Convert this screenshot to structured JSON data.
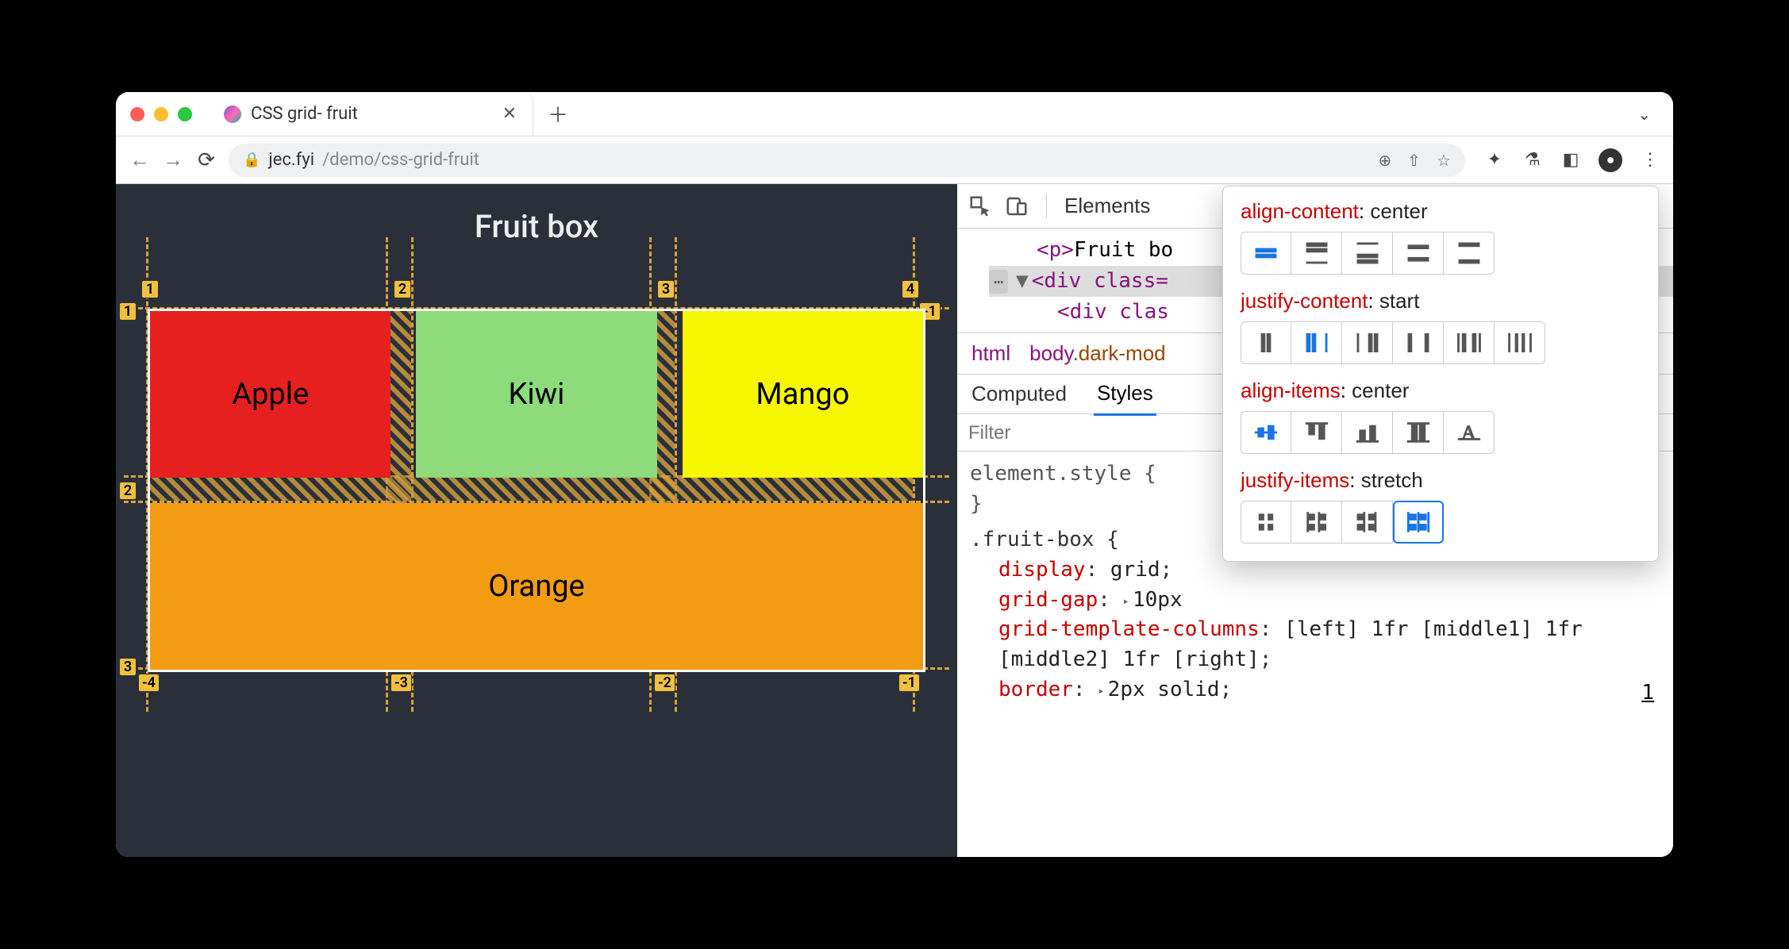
{
  "tab": {
    "title": "CSS grid- fruit"
  },
  "url": {
    "host": "jec.fyi",
    "path": "/demo/css-grid-fruit"
  },
  "page": {
    "heading": "Fruit box",
    "cells": {
      "apple": "Apple",
      "kiwi": "Kiwi",
      "mango": "Mango",
      "orange": "Orange"
    },
    "col_labels_top": [
      "1",
      "2",
      "3",
      "4"
    ],
    "row_labels_left": [
      "1",
      "2",
      "3"
    ],
    "neg_right": "-1",
    "neg_bottom": [
      "-4",
      "-3",
      "-2",
      "-1"
    ]
  },
  "devtools": {
    "main_tab": "Elements",
    "dom": {
      "p_text": "Fruit bo",
      "div_open": "<div class=",
      "div_child": "<div clas",
      "p_tag": "<p>"
    },
    "breadcrumb": {
      "html": "html",
      "body": "body",
      "body_class": ".dark-mod"
    },
    "styles_tabs": {
      "computed": "Computed",
      "styles": "Styles"
    },
    "filter_placeholder": "Filter",
    "rules": {
      "element_style": "element.style {",
      "close": "}",
      "selector": ".fruit-box {",
      "display": {
        "prop": "display",
        "val": "grid"
      },
      "gap": {
        "prop": "grid-gap",
        "val": "10px"
      },
      "gtc": {
        "prop": "grid-template-columns",
        "val": "[left] 1fr [middle1] 1fr [middle2] 1fr [right]"
      },
      "border": {
        "prop": "border",
        "val": "2px solid"
      }
    },
    "rule_link": "1"
  },
  "popover": {
    "align_content": {
      "label": "align-content",
      "value": "center"
    },
    "justify_content": {
      "label": "justify-content",
      "value": "start"
    },
    "align_items": {
      "label": "align-items",
      "value": "center"
    },
    "justify_items": {
      "label": "justify-items",
      "value": "stretch"
    }
  }
}
